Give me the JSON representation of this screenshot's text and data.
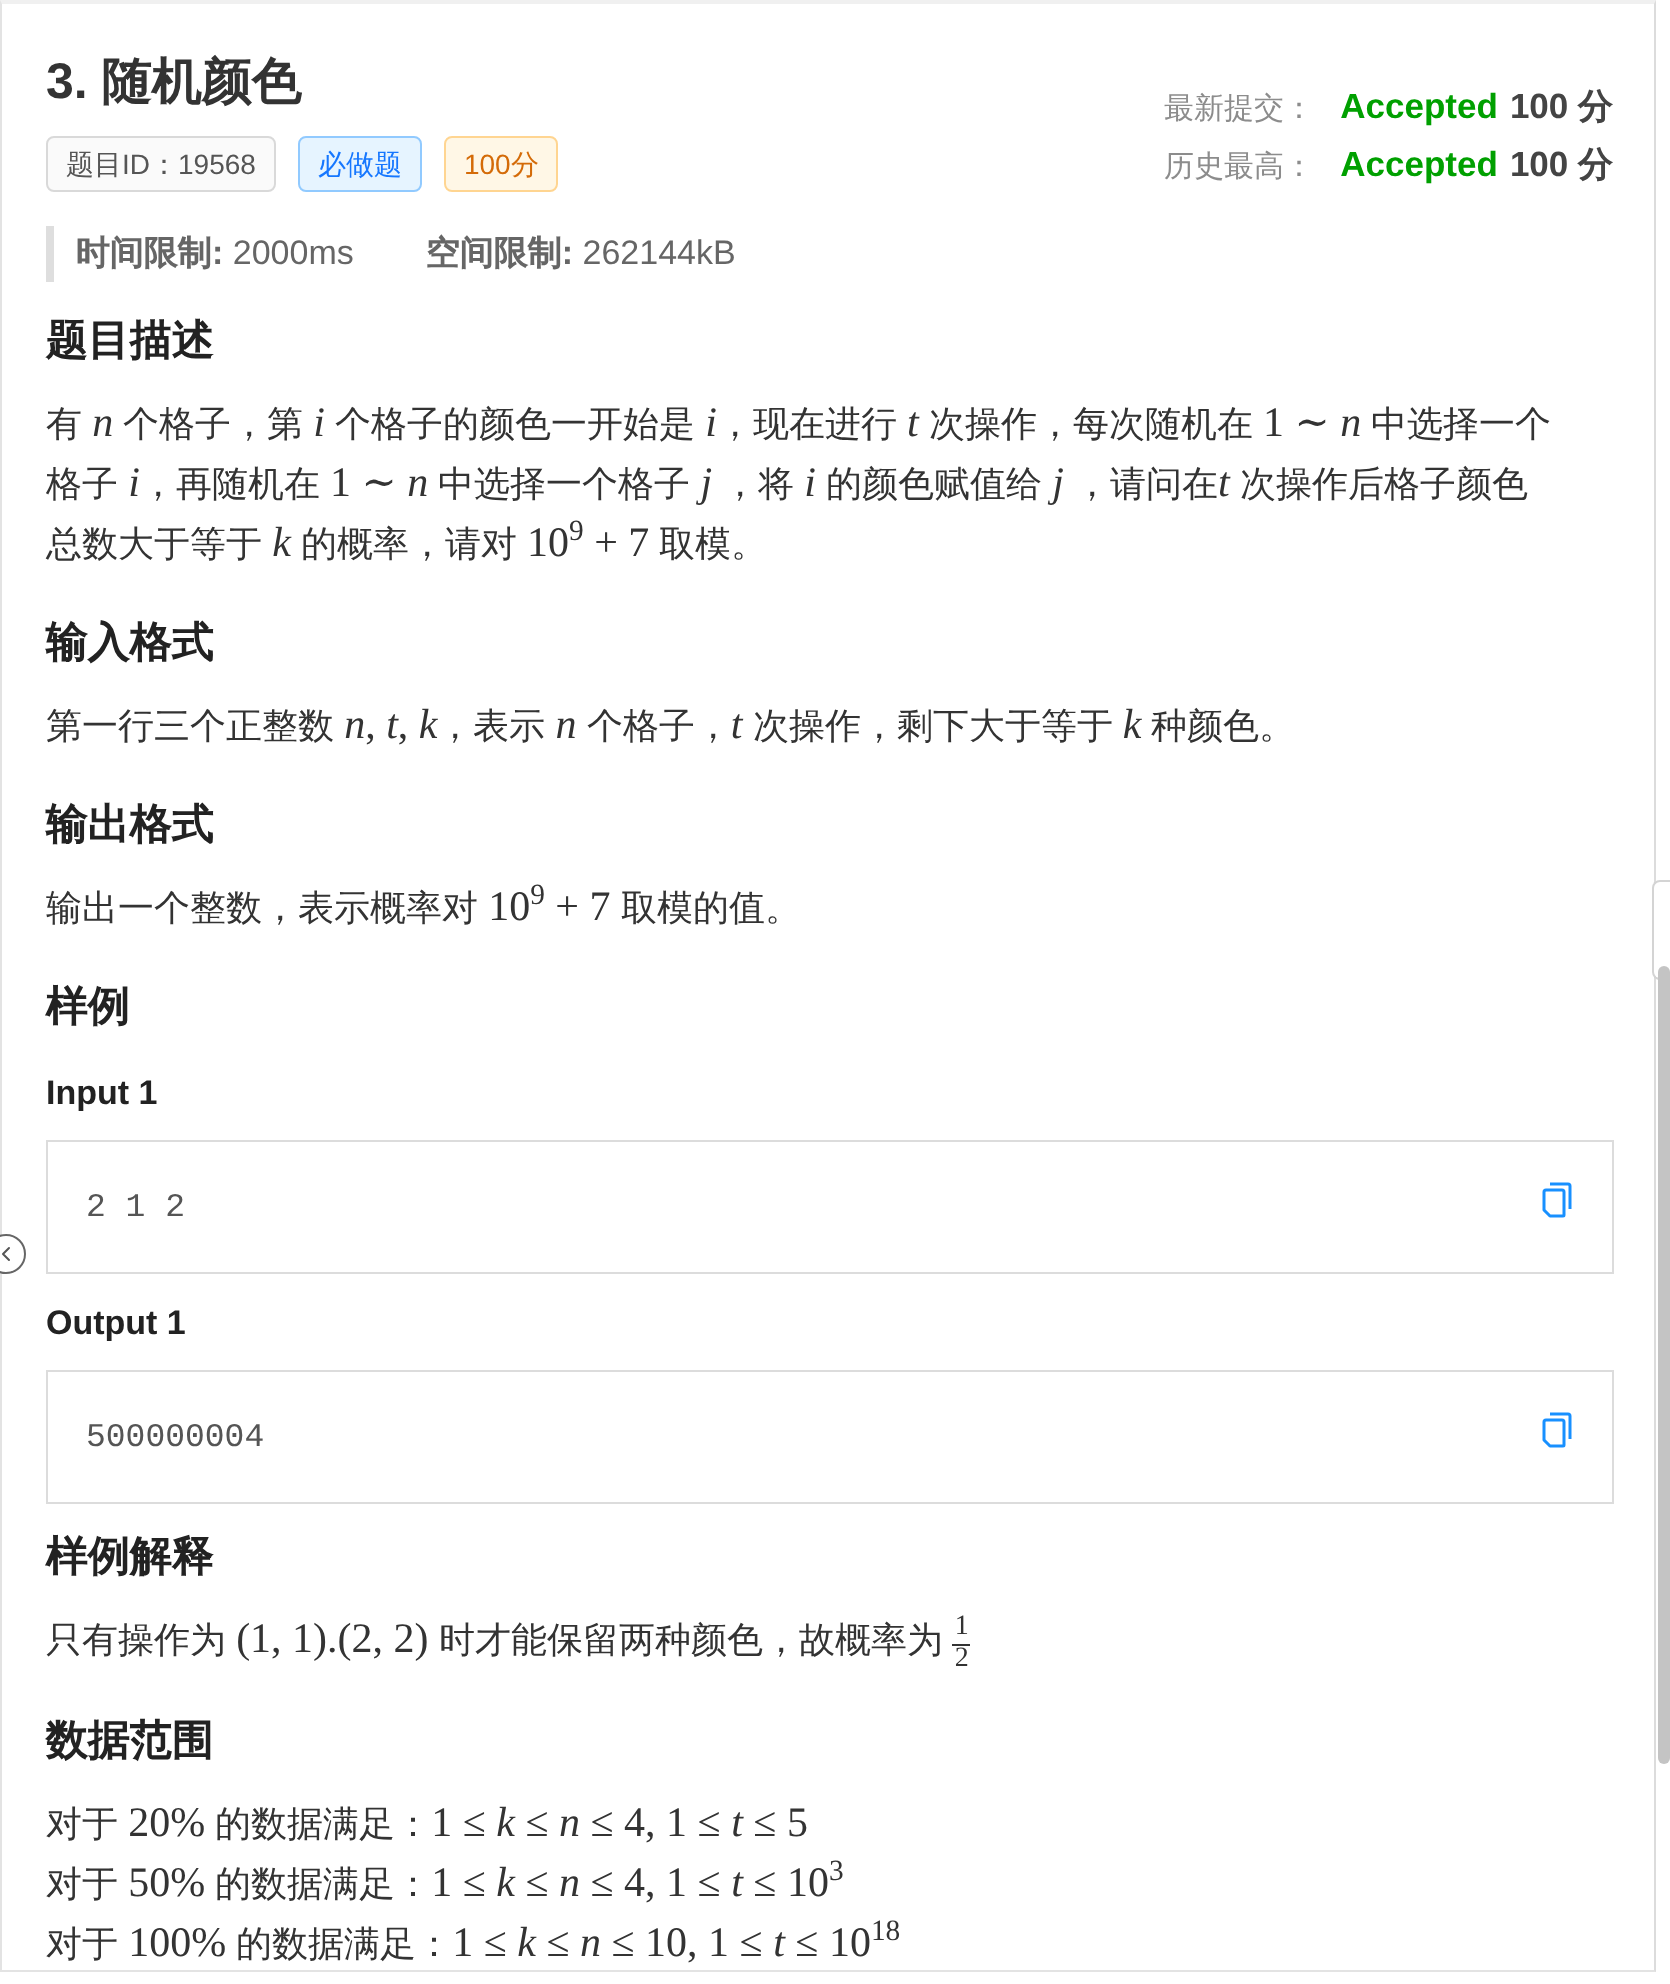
{
  "problem": {
    "title": "3. 随机颜色",
    "tags": [
      {
        "kind": "plain",
        "text": "题目ID：19568"
      },
      {
        "kind": "primary",
        "text": "必做题"
      },
      {
        "kind": "warning",
        "text": "100分"
      }
    ]
  },
  "submissions": [
    {
      "label": "最新提交：",
      "verdict": "Accepted",
      "score": "100 分"
    },
    {
      "label": "历史最高：",
      "verdict": "Accepted",
      "score": "100 分"
    }
  ],
  "limits": [
    "**时间限制:** 2000ms",
    "**空间限制:** 262144kB"
  ],
  "sections": [
    {
      "kind": "text",
      "heading": "题目描述",
      "paragraphs": [
        [
          {
            "kind": "text",
            "text": "有 "
          },
          {
            "kind": "math",
            "text": "*n*"
          },
          {
            "kind": "text",
            "text": " 个格子，第 "
          },
          {
            "kind": "math",
            "text": "*i*"
          },
          {
            "kind": "text",
            "text": " 个格子的颜色一开始是 "
          },
          {
            "kind": "math",
            "text": "*i*"
          },
          {
            "kind": "text",
            "text": "，现在进行 "
          },
          {
            "kind": "math",
            "text": "*t*"
          },
          {
            "kind": "text",
            "text": " 次操作，每次随机在 "
          },
          {
            "kind": "math",
            "text": "1 ∼ *n*"
          },
          {
            "kind": "text",
            "text": " 中选择一个格子 "
          },
          {
            "kind": "math",
            "text": "*i*"
          },
          {
            "kind": "text",
            "text": "，再随机在 "
          },
          {
            "kind": "math",
            "text": "1 ∼ *n*"
          },
          {
            "kind": "text",
            "text": " 中选择一个格子 "
          },
          {
            "kind": "math",
            "text": "*j*"
          },
          {
            "kind": "text",
            "text": " ，将 "
          },
          {
            "kind": "math",
            "text": "*i*"
          },
          {
            "kind": "text",
            "text": " 的颜色赋值给 "
          },
          {
            "kind": "math",
            "text": "*j*"
          },
          {
            "kind": "text",
            "text": " ，请问在"
          },
          {
            "kind": "math",
            "text": "*t*"
          },
          {
            "kind": "text",
            "text": " 次操作后格子颜色总数大于等于 "
          },
          {
            "kind": "math",
            "text": "*k*"
          },
          {
            "kind": "text",
            "text": " 的概率，请对 "
          },
          {
            "kind": "math",
            "text": "10$^{9}$ + 7"
          },
          {
            "kind": "text",
            "text": " 取模。"
          }
        ]
      ]
    },
    {
      "kind": "text",
      "heading": "输入格式",
      "paragraphs": [
        [
          {
            "kind": "text",
            "text": "第一行三个正整数 "
          },
          {
            "kind": "math",
            "text": "*n*, *t*, *k*"
          },
          {
            "kind": "text",
            "text": "，表示 "
          },
          {
            "kind": "math",
            "text": "*n*"
          },
          {
            "kind": "text",
            "text": " 个格子，"
          },
          {
            "kind": "math",
            "text": "*t*"
          },
          {
            "kind": "text",
            "text": " 次操作，剩下大于等于 "
          },
          {
            "kind": "math",
            "text": "*k*"
          },
          {
            "kind": "text",
            "text": " 种颜色。"
          }
        ]
      ]
    },
    {
      "kind": "text",
      "heading": "输出格式",
      "paragraphs": [
        [
          {
            "kind": "text",
            "text": "输出一个整数，表示概率对 "
          },
          {
            "kind": "math",
            "text": "10$^{9}$ + 7"
          },
          {
            "kind": "text",
            "text": " 取模的值。"
          }
        ]
      ]
    },
    {
      "kind": "samples",
      "heading": "样例",
      "samples": [
        {
          "label": "Input 1",
          "content": "2 1 2"
        },
        {
          "label": "Output 1",
          "content": "500000004"
        }
      ]
    },
    {
      "kind": "text",
      "heading": "样例解释",
      "paragraphs": [
        [
          {
            "kind": "text",
            "text": "只有操作为 "
          },
          {
            "kind": "math",
            "text": "(1, 1).(2, 2)"
          },
          {
            "kind": "text",
            "text": " 时才能保留两种颜色，故概率为 "
          },
          {
            "kind": "fraction",
            "numerator": "1",
            "denominator": "2"
          }
        ]
      ]
    },
    {
      "kind": "text",
      "heading": "数据范围",
      "paragraphs": [
        [
          {
            "kind": "text",
            "text": "对于 "
          },
          {
            "kind": "math",
            "text": "20%"
          },
          {
            "kind": "text",
            "text": " 的数据满足："
          },
          {
            "kind": "math",
            "text": "1 ≤ *k* ≤ *n* ≤ 4, 1 ≤ *t* ≤ 5"
          }
        ],
        [
          {
            "kind": "text",
            "text": "对于 "
          },
          {
            "kind": "math",
            "text": "50%"
          },
          {
            "kind": "text",
            "text": " 的数据满足："
          },
          {
            "kind": "math",
            "text": "1 ≤ *k* ≤ *n* ≤ 4, 1 ≤ *t* ≤ 10$^{3}$"
          }
        ],
        [
          {
            "kind": "text",
            "text": "对于 "
          },
          {
            "kind": "math",
            "text": "100%"
          },
          {
            "kind": "text",
            "text": " 的数据满足："
          },
          {
            "kind": "math",
            "text": "1 ≤ *k* ≤ *n* ≤ 10, 1 ≤ *t* ≤ 10$^{18}$"
          }
        ]
      ]
    }
  ]
}
